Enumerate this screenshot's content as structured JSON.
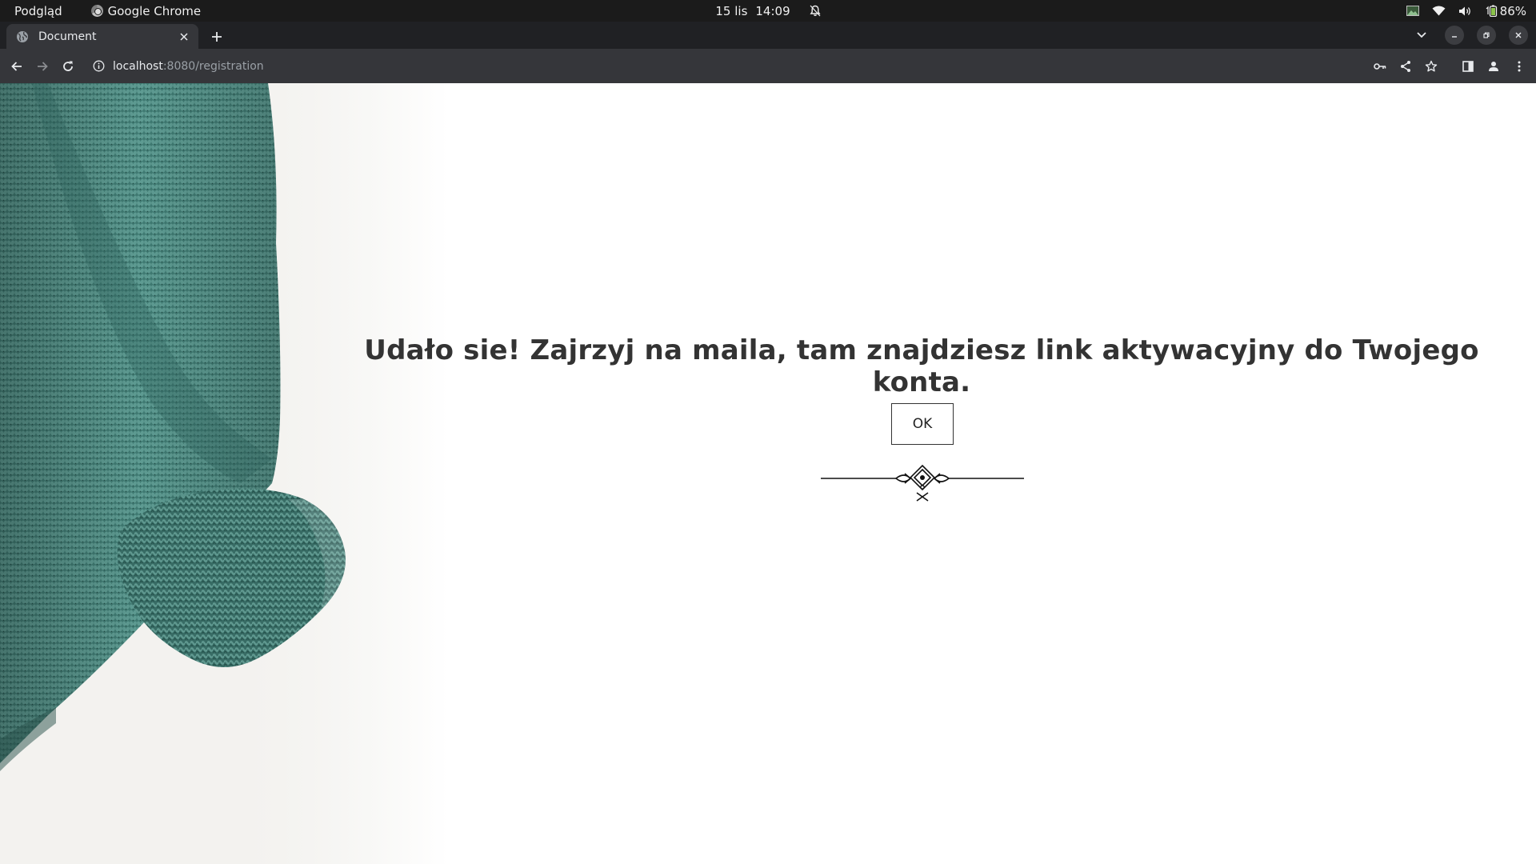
{
  "os_bar": {
    "activities": "Podgląd",
    "app_name": "Google Chrome",
    "date": "15 lis",
    "time": "14:09",
    "battery": "86%"
  },
  "browser": {
    "tab_title": "Document",
    "url_host": "localhost",
    "url_rest": ":8080/registration"
  },
  "page": {
    "message": "Udało sie! Zajrzyj na maila, tam znajdziesz link aktywacyjny do Twojego konta.",
    "ok_label": "OK"
  },
  "colors": {
    "os_bar": "#1b1b1b",
    "tabstrip": "#202124",
    "toolbar": "#35363a",
    "sweater": "#3f7a72",
    "text": "#333333"
  },
  "icons": {
    "tab_favicon": "globe-icon",
    "omnibox_info": "info-icon",
    "ornament": "decorative-divider-icon"
  }
}
